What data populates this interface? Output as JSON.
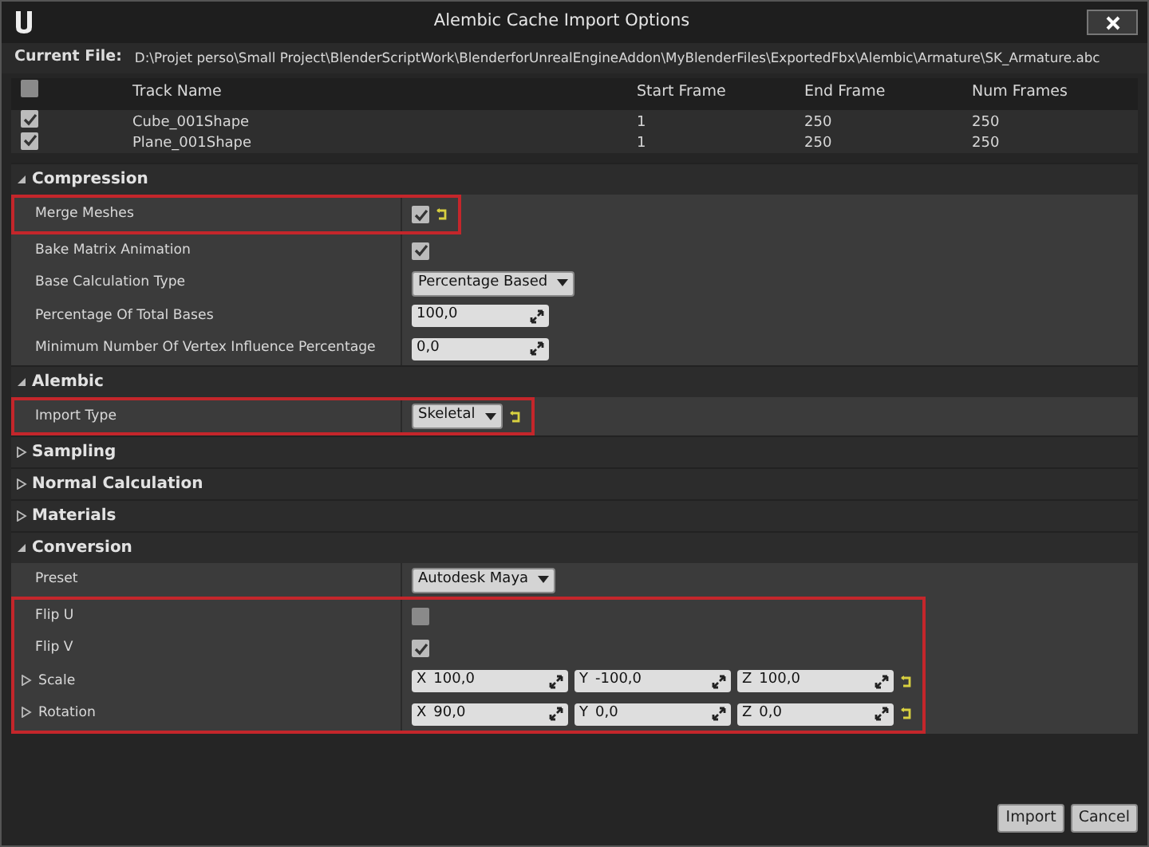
{
  "window": {
    "title": "Alembic Cache Import Options"
  },
  "current_file": {
    "label": "Current File:",
    "path": "D:\\Projet perso\\Small Project\\BlenderScriptWork\\BlenderforUnrealEngineAddon\\MyBlenderFiles\\ExportedFbx\\Alembic\\Armature\\SK_Armature.abc"
  },
  "tracks": {
    "all_checked": false,
    "columns": [
      "Track Name",
      "Start Frame",
      "End Frame",
      "Num Frames"
    ],
    "rows": [
      {
        "checked": true,
        "cells": [
          "Cube_001Shape",
          "1",
          "250",
          "250"
        ]
      },
      {
        "checked": true,
        "cells": [
          "Plane_001Shape",
          "1",
          "250",
          "250"
        ]
      }
    ]
  },
  "sections": [
    {
      "title": "Compression",
      "expanded": true,
      "rows": [
        {
          "label": "Merge Meshes",
          "kind": "checkbox",
          "checked": true,
          "reset": true,
          "highlighted": true
        },
        {
          "label": "Bake Matrix Animation",
          "kind": "checkbox",
          "checked": true,
          "reset": false,
          "highlighted": false
        },
        {
          "label": "Base Calculation Type",
          "kind": "dropdown",
          "value": "Percentage Based",
          "reset": false,
          "highlighted": false
        },
        {
          "label": "Percentage Of Total Bases",
          "kind": "number",
          "value": "100,0",
          "reset": false,
          "highlighted": false
        },
        {
          "label": "Minimum Number Of Vertex Influence Percentage",
          "kind": "number",
          "value": "0,0",
          "reset": false,
          "highlighted": false
        }
      ]
    },
    {
      "title": "Alembic",
      "expanded": true,
      "rows": [
        {
          "label": "Import Type",
          "kind": "dropdown",
          "value": "Skeletal",
          "reset": true,
          "highlighted": true
        }
      ]
    },
    {
      "title": "Sampling",
      "expanded": false
    },
    {
      "title": "Normal Calculation",
      "expanded": false
    },
    {
      "title": "Materials",
      "expanded": false
    },
    {
      "title": "Conversion",
      "expanded": true,
      "rows": [
        {
          "label": "Preset",
          "kind": "dropdown",
          "value": "Autodesk Maya",
          "reset": false,
          "highlighted": false
        },
        {
          "label": "Flip U",
          "kind": "checkbox",
          "checked": false,
          "reset": false,
          "highlighted": true
        },
        {
          "label": "Flip V",
          "kind": "checkbox",
          "checked": true,
          "reset": false,
          "highlighted": true
        },
        {
          "label": "Scale",
          "kind": "vector",
          "expanded": false,
          "axes": [
            {
              "axis": "X",
              "value": "100,0"
            },
            {
              "axis": "Y",
              "value": "-100,0"
            },
            {
              "axis": "Z",
              "value": "100,0"
            }
          ],
          "reset": true,
          "highlighted": true
        },
        {
          "label": "Rotation",
          "kind": "vector",
          "expanded": false,
          "axes": [
            {
              "axis": "X",
              "value": "90,0"
            },
            {
              "axis": "Y",
              "value": "0,0"
            },
            {
              "axis": "Z",
              "value": "0,0"
            }
          ],
          "reset": true,
          "highlighted": true
        }
      ]
    }
  ],
  "buttons": [
    "Import",
    "Cancel"
  ]
}
